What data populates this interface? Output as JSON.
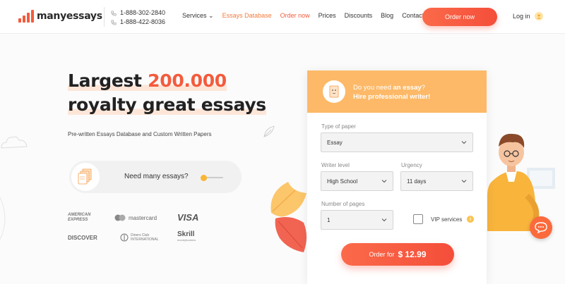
{
  "header": {
    "logo_text": "manyessays",
    "phones": [
      "1-888-302-2840",
      "1-888-422-8036"
    ],
    "nav": [
      {
        "label": "Services ⌄",
        "state": "normal"
      },
      {
        "label": "Essays Database",
        "state": "active"
      },
      {
        "label": "Order now",
        "state": "accent"
      },
      {
        "label": "Prices",
        "state": "normal"
      },
      {
        "label": "Discounts",
        "state": "normal"
      },
      {
        "label": "Blog",
        "state": "normal"
      },
      {
        "label": "Contact Us",
        "state": "normal"
      }
    ],
    "order_button": "Order now",
    "login": "Log in"
  },
  "hero": {
    "title_part1": "Largest ",
    "title_number": "200.000",
    "title_line2": "royalty great essays",
    "subtitle": "Pre-written Essays Database and Custom Written Papers",
    "toggle_label": "Need many essays?"
  },
  "payments": {
    "amex_line1": "AMERICAN",
    "amex_line2": "EXPRESS",
    "mastercard": "mastercard",
    "visa": "VISA",
    "discover": "DISCOVER",
    "diners_line1": "Diners Club",
    "diners_line2": "INTERNATIONAL",
    "skrill": "Skrill",
    "skrill_sub": "moneybookers"
  },
  "form": {
    "question_prefix": "Do you need ",
    "question_bold": "an essay",
    "question_suffix": "?",
    "headline": "Hire professional writer!",
    "type_label": "Type of paper",
    "type_value": "Essay",
    "writer_label": "Writer level",
    "writer_value": "High School",
    "urgency_label": "Urgency",
    "urgency_value": "11 days",
    "pages_label": "Number of pages",
    "pages_value": "1",
    "vip_label": "VIP services",
    "info_glyph": "i",
    "order_label": "Order for",
    "price": "$ 12.99"
  },
  "colors": {
    "accent": "#f45b3c",
    "card_header": "#fdb968",
    "active_nav": "#f47a3c"
  }
}
